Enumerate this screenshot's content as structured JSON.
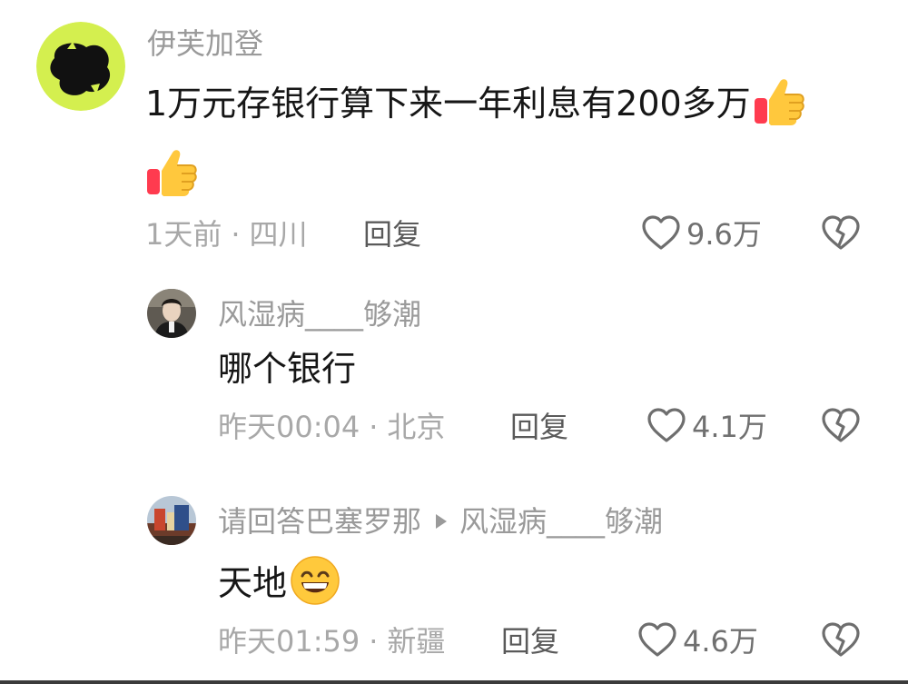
{
  "comments": [
    {
      "username": "伊芙加登",
      "text": "1万元存银行算下来一年利息有200多万",
      "emoji_inline": "thumbs-up",
      "emoji_second_line": "thumbs-up",
      "time": "1天前",
      "location": "四川",
      "reply_label": "回复",
      "likes": "9.6万"
    },
    {
      "username": "风湿病____够潮",
      "text": "哪个银行",
      "time": "昨天00:04",
      "location": "北京",
      "reply_label": "回复",
      "likes": "4.1万"
    },
    {
      "username": "请回答巴塞罗那",
      "reply_to": "风湿病____够潮",
      "text": "天地",
      "emoji_inline": "grinning-face",
      "time": "昨天01:59",
      "location": "新疆",
      "reply_label": "回复",
      "likes": "4.6万"
    }
  ],
  "separator": "·",
  "icons": {
    "like": "heart-outline-icon",
    "dislike": "broken-heart-icon"
  },
  "colors": {
    "username": "#9a9a9a",
    "meta": "#a8a8a8",
    "text": "#161616",
    "avatar1_accent": "#d4ef4f"
  }
}
